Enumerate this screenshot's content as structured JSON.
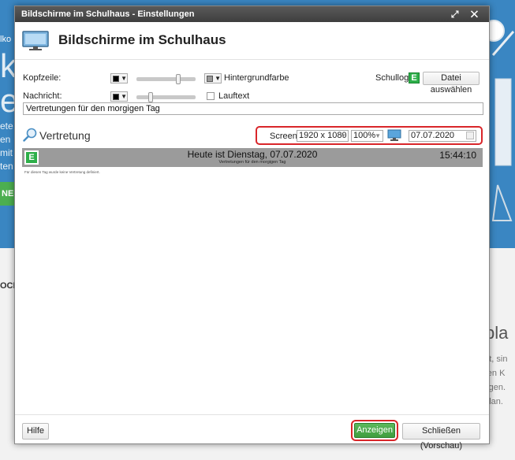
{
  "background": {
    "hero_lines": [
      "lko",
      "k",
      "en",
      "ete\nen\nmit\nten"
    ],
    "hero_button": "NEN",
    "lower_left": "OCH",
    "lower_heading": "pla",
    "lower_para": [
      "eht, sin",
      "eren K",
      "ötigen.",
      "nplan."
    ]
  },
  "dialog": {
    "title": "Bildschirme im Schulhaus - Einstellungen",
    "titlebar_buttons": "⤢ ✕",
    "heading": "Bildschirme im Schulhaus"
  },
  "settings": {
    "kopfzeile_label": "Kopfzeile:",
    "hintergrund_label": "Hintergrundfarbe",
    "schullogo_label": "Schullogo:",
    "datei_button": "Datei auswählen",
    "nachricht_label": "Nachricht:",
    "lauftext_label": "Lauftext",
    "message_value": "Vertretungen für den morgigen Tag",
    "logo_letter": "E",
    "kopfzeile_slider_level": 0.72,
    "nachricht_slider_level": 0.22,
    "header_text_color": "#000000",
    "header_bg_color": "#999999",
    "message_color": "#000000"
  },
  "toolbar": {
    "view_label": "Vertretung",
    "screen_label": "Screen:",
    "resolution": "1920 x 1080",
    "zoom": "100%",
    "date": "07.07.2020"
  },
  "preview": {
    "logo_letter": "E",
    "title": "Heute ist Dienstag, 07.07.2020",
    "subtitle": "Vertretungen für den morgigen Tag",
    "time": "15:44:10",
    "note": "Für diesen Tag wurde keine Vertretung definiert."
  },
  "footer": {
    "help_label": "Hilfe",
    "show_label": "Anzeigen",
    "close_label": "Schließen (Vorschau)"
  },
  "colors": {
    "accent_green": "#2eaf4a",
    "highlight_red": "#d9262a",
    "hero_blue": "#3a86c2"
  }
}
